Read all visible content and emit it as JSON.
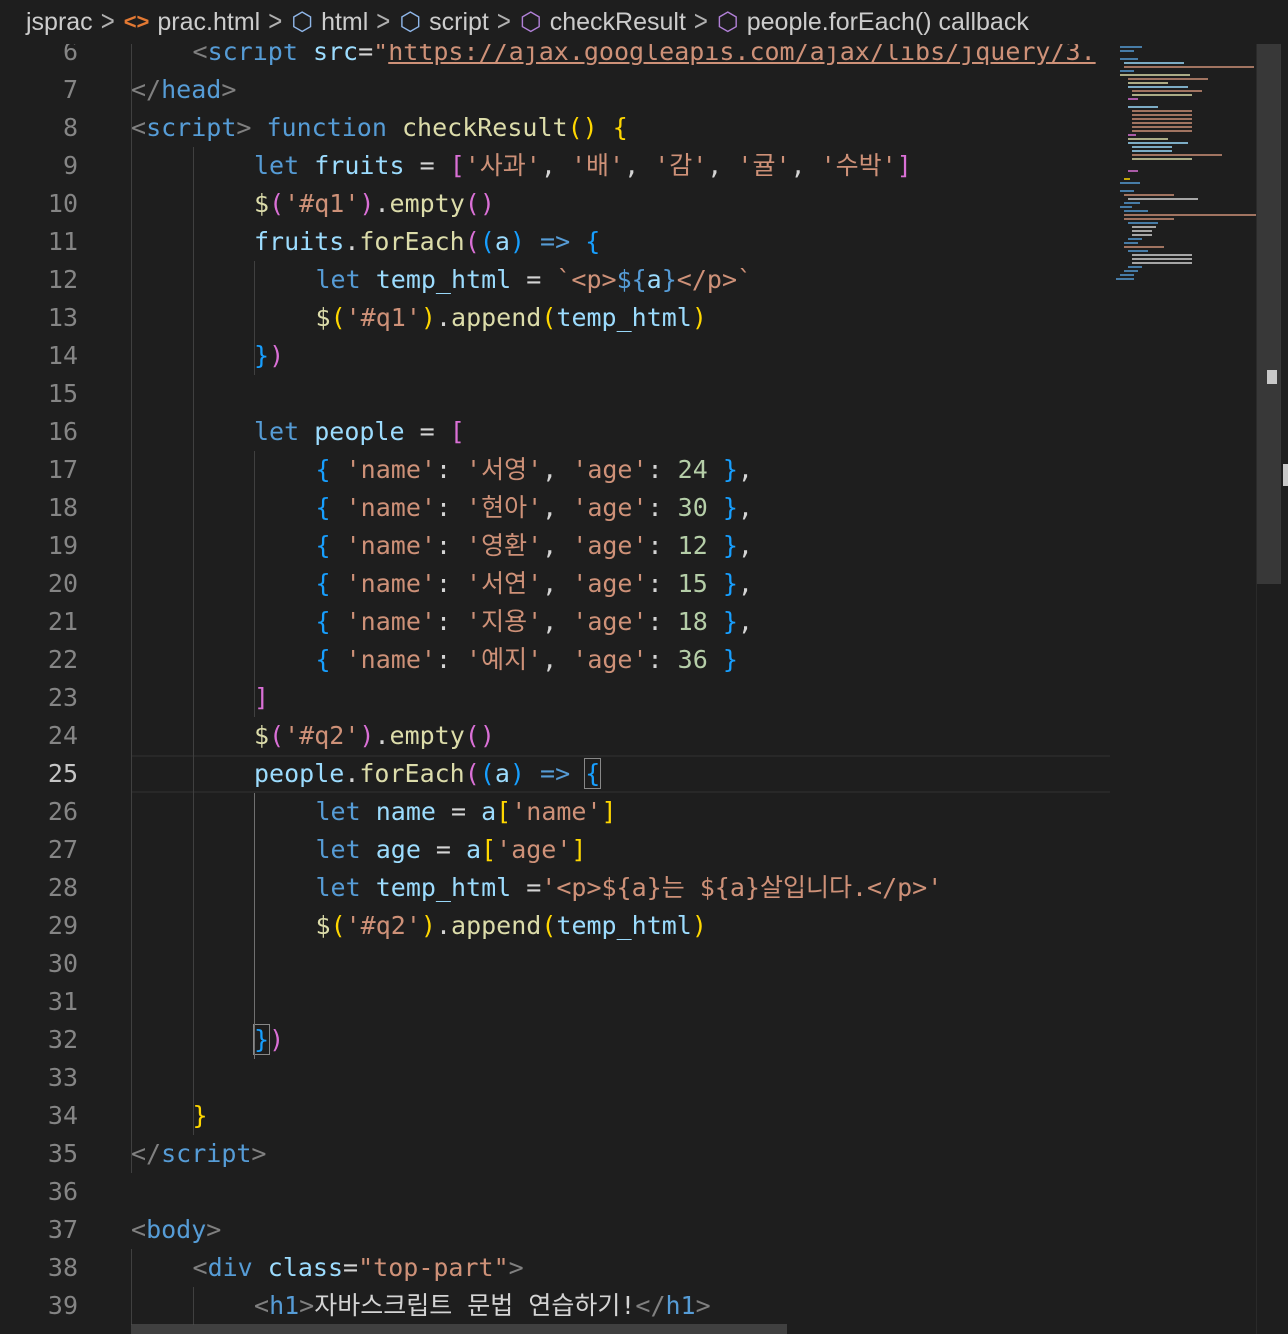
{
  "breadcrumb": [
    {
      "label": "jsprac",
      "icon": ""
    },
    {
      "label": "prac.html",
      "icon": "html-file-icon"
    },
    {
      "label": "html",
      "icon": "cube-icon"
    },
    {
      "label": "script",
      "icon": "cube-icon"
    },
    {
      "label": "checkResult",
      "icon": "method-icon"
    },
    {
      "label": "people.forEach() callback",
      "icon": "method-icon"
    }
  ],
  "editor": {
    "active_line": 25,
    "lines": [
      {
        "n": "6",
        "indent": 1,
        "tokens": [
          [
            "punc",
            "<"
          ],
          [
            "tag",
            "script"
          ],
          [
            "op",
            " "
          ],
          [
            "attr",
            "src"
          ],
          [
            "op",
            "="
          ],
          [
            "str",
            "\""
          ],
          [
            "url",
            "https://ajax.googleapis.com/ajax/libs/jquery/3."
          ]
        ]
      },
      {
        "n": "7",
        "indent": 0,
        "tokens": [
          [
            "punc",
            "</"
          ],
          [
            "tag",
            "head"
          ],
          [
            "punc",
            ">"
          ]
        ]
      },
      {
        "n": "8",
        "indent": 0,
        "tokens": [
          [
            "punc",
            "<"
          ],
          [
            "tag",
            "script"
          ],
          [
            "punc",
            ">"
          ],
          [
            "op",
            " "
          ],
          [
            "kw",
            "function"
          ],
          [
            "op",
            " "
          ],
          [
            "fn",
            "checkResult"
          ],
          [
            "b1",
            "()"
          ],
          [
            "op",
            " "
          ],
          [
            "b1",
            "{"
          ]
        ]
      },
      {
        "n": "9",
        "indent": 2,
        "tokens": [
          [
            "kw",
            "let"
          ],
          [
            "op",
            " "
          ],
          [
            "var",
            "fruits"
          ],
          [
            "op",
            " = "
          ],
          [
            "b2",
            "["
          ],
          [
            "str",
            "'사과'"
          ],
          [
            "op",
            ", "
          ],
          [
            "str",
            "'배'"
          ],
          [
            "op",
            ", "
          ],
          [
            "str",
            "'감'"
          ],
          [
            "op",
            ", "
          ],
          [
            "str",
            "'귤'"
          ],
          [
            "op",
            ", "
          ],
          [
            "str",
            "'수박'"
          ],
          [
            "b2",
            "]"
          ]
        ]
      },
      {
        "n": "10",
        "indent": 2,
        "tokens": [
          [
            "fn",
            "$"
          ],
          [
            "b2",
            "("
          ],
          [
            "str",
            "'#q1'"
          ],
          [
            "b2",
            ")"
          ],
          [
            "op",
            "."
          ],
          [
            "fn",
            "empty"
          ],
          [
            "b2",
            "()"
          ]
        ]
      },
      {
        "n": "11",
        "indent": 2,
        "tokens": [
          [
            "var",
            "fruits"
          ],
          [
            "op",
            "."
          ],
          [
            "fn",
            "forEach"
          ],
          [
            "b2",
            "("
          ],
          [
            "b3",
            "("
          ],
          [
            "var",
            "a"
          ],
          [
            "b3",
            ")"
          ],
          [
            "op",
            " "
          ],
          [
            "kw",
            "=>"
          ],
          [
            "op",
            " "
          ],
          [
            "b3",
            "{"
          ]
        ]
      },
      {
        "n": "12",
        "indent": 3,
        "tokens": [
          [
            "kw",
            "let"
          ],
          [
            "op",
            " "
          ],
          [
            "var",
            "temp_html"
          ],
          [
            "op",
            " = "
          ],
          [
            "str",
            "`<p>"
          ],
          [
            "kw",
            "${"
          ],
          [
            "var",
            "a"
          ],
          [
            "kw",
            "}"
          ],
          [
            "str",
            "</p>`"
          ]
        ]
      },
      {
        "n": "13",
        "indent": 3,
        "tokens": [
          [
            "fn",
            "$"
          ],
          [
            "b1",
            "("
          ],
          [
            "str",
            "'#q1'"
          ],
          [
            "b1",
            ")"
          ],
          [
            "op",
            "."
          ],
          [
            "fn",
            "append"
          ],
          [
            "b1",
            "("
          ],
          [
            "var",
            "temp_html"
          ],
          [
            "b1",
            ")"
          ]
        ]
      },
      {
        "n": "14",
        "indent": 2,
        "tokens": [
          [
            "b3",
            "}"
          ],
          [
            "b2",
            ")"
          ]
        ]
      },
      {
        "n": "15",
        "indent": 0,
        "tokens": []
      },
      {
        "n": "16",
        "indent": 2,
        "tokens": [
          [
            "kw",
            "let"
          ],
          [
            "op",
            " "
          ],
          [
            "var",
            "people"
          ],
          [
            "op",
            " = "
          ],
          [
            "b2",
            "["
          ]
        ]
      },
      {
        "n": "17",
        "indent": 3,
        "tokens": [
          [
            "b3",
            "{"
          ],
          [
            "op",
            " "
          ],
          [
            "str",
            "'name'"
          ],
          [
            "op",
            ": "
          ],
          [
            "str",
            "'서영'"
          ],
          [
            "op",
            ", "
          ],
          [
            "str",
            "'age'"
          ],
          [
            "op",
            ": "
          ],
          [
            "num",
            "24"
          ],
          [
            "op",
            " "
          ],
          [
            "b3",
            "}"
          ],
          [
            "op",
            ","
          ]
        ]
      },
      {
        "n": "18",
        "indent": 3,
        "tokens": [
          [
            "b3",
            "{"
          ],
          [
            "op",
            " "
          ],
          [
            "str",
            "'name'"
          ],
          [
            "op",
            ": "
          ],
          [
            "str",
            "'현아'"
          ],
          [
            "op",
            ", "
          ],
          [
            "str",
            "'age'"
          ],
          [
            "op",
            ": "
          ],
          [
            "num",
            "30"
          ],
          [
            "op",
            " "
          ],
          [
            "b3",
            "}"
          ],
          [
            "op",
            ","
          ]
        ]
      },
      {
        "n": "19",
        "indent": 3,
        "tokens": [
          [
            "b3",
            "{"
          ],
          [
            "op",
            " "
          ],
          [
            "str",
            "'name'"
          ],
          [
            "op",
            ": "
          ],
          [
            "str",
            "'영환'"
          ],
          [
            "op",
            ", "
          ],
          [
            "str",
            "'age'"
          ],
          [
            "op",
            ": "
          ],
          [
            "num",
            "12"
          ],
          [
            "op",
            " "
          ],
          [
            "b3",
            "}"
          ],
          [
            "op",
            ","
          ]
        ]
      },
      {
        "n": "20",
        "indent": 3,
        "tokens": [
          [
            "b3",
            "{"
          ],
          [
            "op",
            " "
          ],
          [
            "str",
            "'name'"
          ],
          [
            "op",
            ": "
          ],
          [
            "str",
            "'서연'"
          ],
          [
            "op",
            ", "
          ],
          [
            "str",
            "'age'"
          ],
          [
            "op",
            ": "
          ],
          [
            "num",
            "15"
          ],
          [
            "op",
            " "
          ],
          [
            "b3",
            "}"
          ],
          [
            "op",
            ","
          ]
        ]
      },
      {
        "n": "21",
        "indent": 3,
        "tokens": [
          [
            "b3",
            "{"
          ],
          [
            "op",
            " "
          ],
          [
            "str",
            "'name'"
          ],
          [
            "op",
            ": "
          ],
          [
            "str",
            "'지용'"
          ],
          [
            "op",
            ", "
          ],
          [
            "str",
            "'age'"
          ],
          [
            "op",
            ": "
          ],
          [
            "num",
            "18"
          ],
          [
            "op",
            " "
          ],
          [
            "b3",
            "}"
          ],
          [
            "op",
            ","
          ]
        ]
      },
      {
        "n": "22",
        "indent": 3,
        "tokens": [
          [
            "b3",
            "{"
          ],
          [
            "op",
            " "
          ],
          [
            "str",
            "'name'"
          ],
          [
            "op",
            ": "
          ],
          [
            "str",
            "'예지'"
          ],
          [
            "op",
            ", "
          ],
          [
            "str",
            "'age'"
          ],
          [
            "op",
            ": "
          ],
          [
            "num",
            "36"
          ],
          [
            "op",
            " "
          ],
          [
            "b3",
            "}"
          ]
        ]
      },
      {
        "n": "23",
        "indent": 2,
        "tokens": [
          [
            "b2",
            "]"
          ]
        ]
      },
      {
        "n": "24",
        "indent": 2,
        "tokens": [
          [
            "fn",
            "$"
          ],
          [
            "b2",
            "("
          ],
          [
            "str",
            "'#q2'"
          ],
          [
            "b2",
            ")"
          ],
          [
            "op",
            "."
          ],
          [
            "fn",
            "empty"
          ],
          [
            "b2",
            "()"
          ]
        ]
      },
      {
        "n": "25",
        "indent": 2,
        "tokens": [
          [
            "var",
            "people"
          ],
          [
            "op",
            "."
          ],
          [
            "fn",
            "forEach"
          ],
          [
            "b2",
            "("
          ],
          [
            "b3",
            "("
          ],
          [
            "var",
            "a"
          ],
          [
            "b3",
            ")"
          ],
          [
            "op",
            " "
          ],
          [
            "kw",
            "=>"
          ],
          [
            "op",
            " "
          ],
          [
            "b3m",
            "{"
          ]
        ]
      },
      {
        "n": "26",
        "indent": 3,
        "tokens": [
          [
            "kw",
            "let"
          ],
          [
            "op",
            " "
          ],
          [
            "var",
            "name"
          ],
          [
            "op",
            " = "
          ],
          [
            "var",
            "a"
          ],
          [
            "b1",
            "["
          ],
          [
            "str",
            "'name'"
          ],
          [
            "b1",
            "]"
          ]
        ]
      },
      {
        "n": "27",
        "indent": 3,
        "tokens": [
          [
            "kw",
            "let"
          ],
          [
            "op",
            " "
          ],
          [
            "var",
            "age"
          ],
          [
            "op",
            " = "
          ],
          [
            "var",
            "a"
          ],
          [
            "b1",
            "["
          ],
          [
            "str",
            "'age'"
          ],
          [
            "b1",
            "]"
          ]
        ]
      },
      {
        "n": "28",
        "indent": 3,
        "tokens": [
          [
            "kw",
            "let"
          ],
          [
            "op",
            " "
          ],
          [
            "var",
            "temp_html"
          ],
          [
            "op",
            " ="
          ],
          [
            "str",
            "'<p>${a}는 ${a}살입니다.</p>'"
          ]
        ]
      },
      {
        "n": "29",
        "indent": 3,
        "tokens": [
          [
            "fn",
            "$"
          ],
          [
            "b1",
            "("
          ],
          [
            "str",
            "'#q2'"
          ],
          [
            "b1",
            ")"
          ],
          [
            "op",
            "."
          ],
          [
            "fn",
            "append"
          ],
          [
            "b1",
            "("
          ],
          [
            "var",
            "temp_html"
          ],
          [
            "b1",
            ")"
          ]
        ]
      },
      {
        "n": "30",
        "indent": 0,
        "tokens": []
      },
      {
        "n": "31",
        "indent": 0,
        "tokens": []
      },
      {
        "n": "32",
        "indent": 2,
        "tokens": [
          [
            "b3m",
            "}"
          ],
          [
            "b2",
            ")"
          ]
        ]
      },
      {
        "n": "33",
        "indent": 0,
        "tokens": []
      },
      {
        "n": "34",
        "indent": 1,
        "tokens": [
          [
            "b1",
            "}"
          ]
        ]
      },
      {
        "n": "35",
        "indent": 0,
        "tokens": [
          [
            "punc",
            "</"
          ],
          [
            "tag",
            "script"
          ],
          [
            "punc",
            ">"
          ]
        ]
      },
      {
        "n": "36",
        "indent": 0,
        "tokens": []
      },
      {
        "n": "37",
        "indent": 0,
        "tokens": [
          [
            "punc",
            "<"
          ],
          [
            "tag",
            "body"
          ],
          [
            "punc",
            ">"
          ]
        ]
      },
      {
        "n": "38",
        "indent": 1,
        "tokens": [
          [
            "punc",
            "<"
          ],
          [
            "tag",
            "div"
          ],
          [
            "op",
            " "
          ],
          [
            "attr",
            "class"
          ],
          [
            "op",
            "="
          ],
          [
            "str",
            "\"top-part\""
          ],
          [
            "punc",
            ">"
          ]
        ]
      },
      {
        "n": "39",
        "indent": 2,
        "tokens": [
          [
            "punc",
            "<"
          ],
          [
            "tag",
            "h1"
          ],
          [
            "punc",
            ">"
          ],
          [
            "txt",
            "자바스크립트 문법 연습하기!"
          ],
          [
            "punc",
            "</"
          ],
          [
            "tag",
            "h1"
          ],
          [
            "punc",
            ">"
          ]
        ]
      }
    ]
  },
  "colors": {
    "background": "#1e1e1e",
    "keyword": "#569cd6",
    "string": "#ce9178",
    "function": "#dcdcaa",
    "variable": "#9cdcfe",
    "number": "#b5cea8",
    "bracket_gold": "#ffd700",
    "bracket_orchid": "#da70d6",
    "bracket_blue": "#179fff"
  }
}
